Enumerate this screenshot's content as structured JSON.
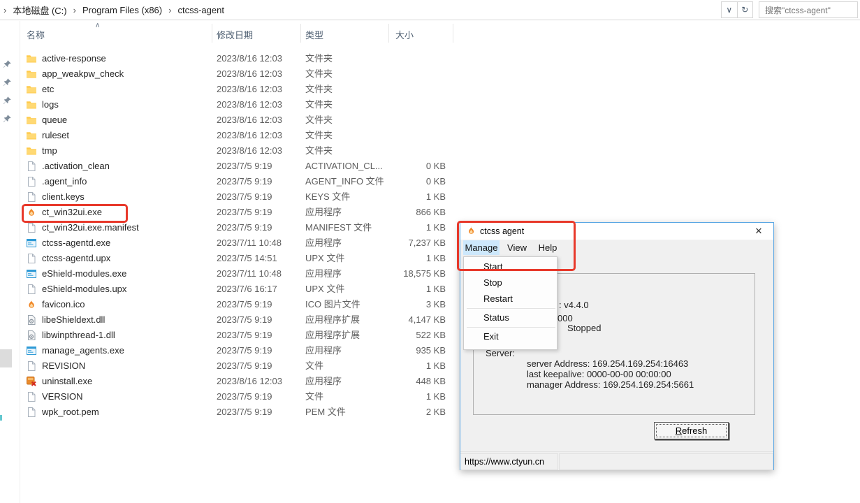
{
  "icons": {
    "crumb_sep": "›",
    "chevron_down": "∨",
    "refresh": "↻",
    "close": "✕",
    "sort_caret": "∧"
  },
  "explorer": {
    "breadcrumb": [
      "本地磁盘 (C:)",
      "Program Files (x86)",
      "ctcss-agent"
    ],
    "toolbar": {
      "search_text": "搜索\"ctcss-agent\""
    },
    "columns": {
      "name": "名称",
      "date": "修改日期",
      "type": "类型",
      "size": "大小"
    },
    "pin_count": 4,
    "files": [
      {
        "icon": "folder",
        "name": "active-response",
        "date": "2023/8/16 12:03",
        "type": "文件夹",
        "size": ""
      },
      {
        "icon": "folder",
        "name": "app_weakpw_check",
        "date": "2023/8/16 12:03",
        "type": "文件夹",
        "size": ""
      },
      {
        "icon": "folder",
        "name": "etc",
        "date": "2023/8/16 12:03",
        "type": "文件夹",
        "size": ""
      },
      {
        "icon": "folder",
        "name": "logs",
        "date": "2023/8/16 12:03",
        "type": "文件夹",
        "size": ""
      },
      {
        "icon": "folder",
        "name": "queue",
        "date": "2023/8/16 12:03",
        "type": "文件夹",
        "size": ""
      },
      {
        "icon": "folder",
        "name": "ruleset",
        "date": "2023/8/16 12:03",
        "type": "文件夹",
        "size": ""
      },
      {
        "icon": "folder",
        "name": "tmp",
        "date": "2023/8/16 12:03",
        "type": "文件夹",
        "size": ""
      },
      {
        "icon": "file",
        "name": ".activation_clean",
        "date": "2023/7/5 9:19",
        "type": "ACTIVATION_CL...",
        "size": "0 KB"
      },
      {
        "icon": "file",
        "name": ".agent_info",
        "date": "2023/7/5 9:19",
        "type": "AGENT_INFO 文件",
        "size": "0 KB"
      },
      {
        "icon": "file",
        "name": "client.keys",
        "date": "2023/7/5 9:19",
        "type": "KEYS 文件",
        "size": "1 KB"
      },
      {
        "icon": "flame",
        "name": "ct_win32ui.exe",
        "date": "2023/7/5 9:19",
        "type": "应用程序",
        "size": "866 KB"
      },
      {
        "icon": "file",
        "name": "ct_win32ui.exe.manifest",
        "date": "2023/7/5 9:19",
        "type": "MANIFEST 文件",
        "size": "1 KB"
      },
      {
        "icon": "exe",
        "name": "ctcss-agentd.exe",
        "date": "2023/7/11 10:48",
        "type": "应用程序",
        "size": "7,237 KB"
      },
      {
        "icon": "file",
        "name": "ctcss-agentd.upx",
        "date": "2023/7/5 14:51",
        "type": "UPX 文件",
        "size": "1 KB"
      },
      {
        "icon": "exe",
        "name": "eShield-modules.exe",
        "date": "2023/7/11 10:48",
        "type": "应用程序",
        "size": "18,575 KB"
      },
      {
        "icon": "file",
        "name": "eShield-modules.upx",
        "date": "2023/7/6 16:17",
        "type": "UPX 文件",
        "size": "1 KB"
      },
      {
        "icon": "flame",
        "name": "favicon.ico",
        "date": "2023/7/5 9:19",
        "type": "ICO 图片文件",
        "size": "3 KB"
      },
      {
        "icon": "dll",
        "name": "libeShieldext.dll",
        "date": "2023/7/5 9:19",
        "type": "应用程序扩展",
        "size": "4,147 KB"
      },
      {
        "icon": "dll",
        "name": "libwinpthread-1.dll",
        "date": "2023/7/5 9:19",
        "type": "应用程序扩展",
        "size": "522 KB"
      },
      {
        "icon": "exe",
        "name": "manage_agents.exe",
        "date": "2023/7/5 9:19",
        "type": "应用程序",
        "size": "935 KB"
      },
      {
        "icon": "file",
        "name": "REVISION",
        "date": "2023/7/5 9:19",
        "type": "文件",
        "size": "1 KB"
      },
      {
        "icon": "uninstall",
        "name": "uninstall.exe",
        "date": "2023/8/16 12:03",
        "type": "应用程序",
        "size": "448 KB"
      },
      {
        "icon": "file",
        "name": "VERSION",
        "date": "2023/7/5 9:19",
        "type": "文件",
        "size": "1 KB"
      },
      {
        "icon": "file",
        "name": "wpk_root.pem",
        "date": "2023/7/5 9:19",
        "type": "PEM 文件",
        "size": "2 KB"
      }
    ]
  },
  "dialog": {
    "title": "ctcss agent",
    "menubar": [
      "Manage",
      "View",
      "Help"
    ],
    "menu_items": [
      {
        "label": "Start"
      },
      {
        "label": "Stop"
      },
      {
        "label": "Restart"
      },
      {
        "sep": true
      },
      {
        "label": "Status"
      },
      {
        "sep": true
      },
      {
        "label": "Exit"
      }
    ],
    "status": {
      "version_fragment": ": v4.4.0",
      "pid_fragment": "000",
      "state_fragment": "Stopped",
      "server_label": "Server:",
      "server_lines": [
        "server Address: 169.254.169.254:16463",
        "last keepalive: 0000-00-00 00:00:00",
        "manager Address: 169.254.169.254:5661"
      ]
    },
    "refresh": {
      "mnemonic": "R",
      "rest": "efresh"
    },
    "statusbar_url": "https://www.ctyun.cn"
  },
  "annotation": {
    "highlight_color": "#e8392b"
  }
}
